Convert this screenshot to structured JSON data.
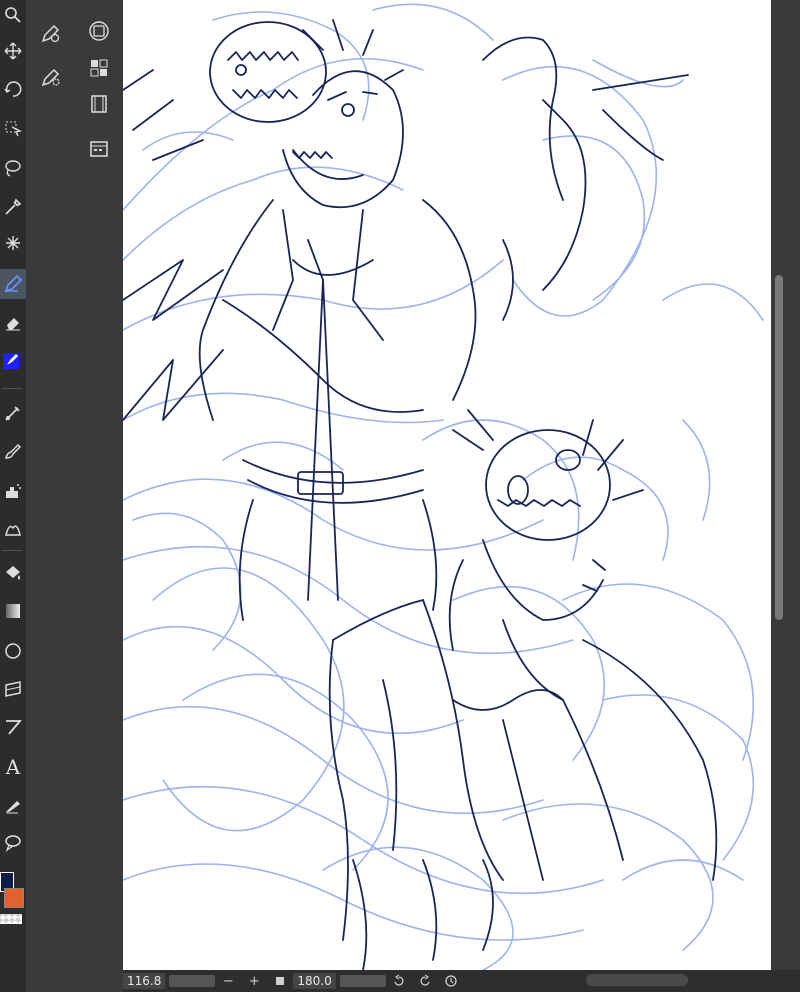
{
  "toolbar": {
    "tools": [
      "zoom",
      "move",
      "rotate",
      "select",
      "lasso",
      "eyedropper",
      "auto-select",
      "pen",
      "eraser",
      "fill-pen",
      "figure-ruler",
      "brush",
      "airbrush",
      "blend",
      "fill",
      "gradient",
      "ellipse",
      "frame",
      "ruler",
      "text",
      "correct-line",
      "balloon"
    ],
    "active_tool": "pen",
    "text_tool_glyph": "A"
  },
  "colors": {
    "main": "#0d1c48",
    "sub": "#e0622c",
    "accent": "#4f6bff"
  },
  "bottom_bar": {
    "zoom_value": "116.8",
    "angle_value": "180.0",
    "zoom_out_label": "−",
    "zoom_in_label": "+"
  }
}
